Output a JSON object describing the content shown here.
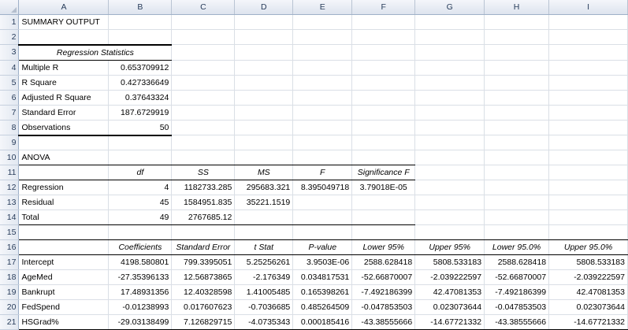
{
  "columns": [
    "A",
    "B",
    "C",
    "D",
    "E",
    "F",
    "G",
    "H",
    "I"
  ],
  "rows": {
    "r1": "1",
    "r2": "2",
    "r3": "3",
    "r4": "4",
    "r5": "5",
    "r6": "6",
    "r7": "7",
    "r8": "8",
    "r9": "9",
    "r10": "10",
    "r11": "11",
    "r12": "12",
    "r13": "13",
    "r14": "14",
    "r15": "15",
    "r16": "16",
    "r17": "17",
    "r18": "18",
    "r19": "19",
    "r20": "20",
    "r21": "21"
  },
  "summary_title": "SUMMARY OUTPUT",
  "regression_stats": {
    "header": "Regression Statistics",
    "items": [
      {
        "label": "Multiple R",
        "value": "0.653709912"
      },
      {
        "label": "R Square",
        "value": "0.427336649"
      },
      {
        "label": "Adjusted R Square",
        "value": "0.37643324"
      },
      {
        "label": "Standard Error",
        "value": "187.6729919"
      },
      {
        "label": "Observations",
        "value": "50"
      }
    ]
  },
  "anova": {
    "title": "ANOVA",
    "headers": {
      "df": "df",
      "ss": "SS",
      "ms": "MS",
      "f": "F",
      "sig": "Significance F"
    },
    "rows": [
      {
        "label": "Regression",
        "df": "4",
        "ss": "1182733.285",
        "ms": "295683.321",
        "f": "8.395049718",
        "sig": "3.79018E-05"
      },
      {
        "label": "Residual",
        "df": "45",
        "ss": "1584951.835",
        "ms": "35221.1519",
        "f": "",
        "sig": ""
      },
      {
        "label": "Total",
        "df": "49",
        "ss": "2767685.12",
        "ms": "",
        "f": "",
        "sig": ""
      }
    ]
  },
  "coefficients": {
    "headers": {
      "coef": "Coefficients",
      "se": "Standard Error",
      "t": "t Stat",
      "p": "P-value",
      "l95": "Lower 95%",
      "u95": "Upper 95%",
      "l950": "Lower 95.0%",
      "u950": "Upper 95.0%"
    },
    "rows": [
      {
        "label": "Intercept",
        "coef": "4198.580801",
        "se": "799.3395051",
        "t": "5.25256261",
        "p": "3.9503E-06",
        "l95": "2588.628418",
        "u95": "5808.533183",
        "l950": "2588.628418",
        "u950": "5808.533183"
      },
      {
        "label": "AgeMed",
        "coef": "-27.35396133",
        "se": "12.56873865",
        "t": "-2.176349",
        "p": "0.034817531",
        "l95": "-52.66870007",
        "u95": "-2.039222597",
        "l950": "-52.66870007",
        "u950": "-2.039222597"
      },
      {
        "label": "Bankrupt",
        "coef": "17.48931356",
        "se": "12.40328598",
        "t": "1.41005485",
        "p": "0.165398261",
        "l95": "-7.492186399",
        "u95": "42.47081353",
        "l950": "-7.492186399",
        "u950": "42.47081353"
      },
      {
        "label": "FedSpend",
        "coef": "-0.01238993",
        "se": "0.017607623",
        "t": "-0.7036685",
        "p": "0.485264509",
        "l95": "-0.047853503",
        "u95": "0.023073644",
        "l950": "-0.047853503",
        "u950": "0.023073644"
      },
      {
        "label": "HSGrad%",
        "coef": "-29.03138499",
        "se": "7.126829715",
        "t": "-4.0735343",
        "p": "0.000185416",
        "l95": "-43.38555666",
        "u95": "-14.67721332",
        "l950": "-43.38555666",
        "u950": "-14.67721332"
      }
    ]
  }
}
